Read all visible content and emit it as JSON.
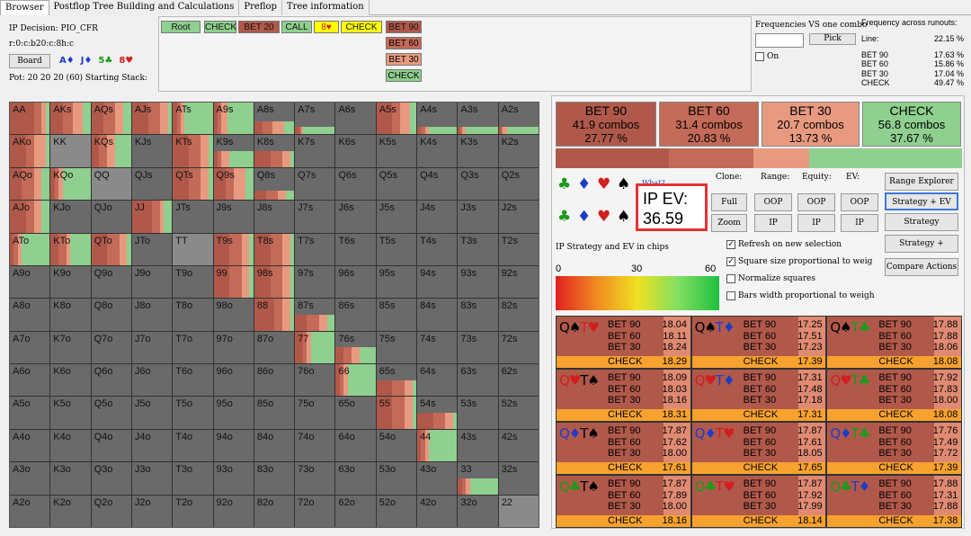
{
  "tabs": [
    "Browser",
    "Postflop Tree Building and Calculations",
    "Preflop",
    "Tree information"
  ],
  "info": {
    "decision": "IP Decision:   PIO_CFR",
    "board_line": "r:0:c:b20:c:8h:c",
    "board_button": "Board",
    "board_cards": [
      {
        "t": "A♦",
        "c": "#1e3cc8"
      },
      {
        "t": "J♦",
        "c": "#1e3cc8"
      },
      {
        "t": "5♣",
        "c": "#1a9b1a"
      },
      {
        "t": "8♥",
        "c": "#d21e1e"
      }
    ],
    "pot": "Pot: 20 20 20 (60) Starting Stack:"
  },
  "actions": {
    "row1": [
      {
        "label": "Root",
        "bg": "#8fcf8f"
      },
      {
        "label": "CHECK",
        "bg": "#8fcf8f"
      },
      {
        "label": "BET 20",
        "bg": "#b0594b"
      },
      {
        "label": "CALL",
        "bg": "#8fcf8f"
      },
      {
        "label": "8♥",
        "bg": "#ffff00"
      },
      {
        "label": "CHECK",
        "bg": "#ffff00"
      },
      {
        "label": "BET 90",
        "bg": "#b0594b"
      }
    ],
    "col": [
      {
        "label": "BET 60",
        "bg": "#c46a58"
      },
      {
        "label": "BET 30",
        "bg": "#e79a80"
      },
      {
        "label": "CHECK",
        "bg": "#8fcf8f"
      }
    ]
  },
  "freq": {
    "title": "Frequencies VS one combo",
    "pick": "Pick",
    "on": "On"
  },
  "runouts": {
    "title": "Frequency across runouts:",
    "line_label": "Line:",
    "line_value": "22.15 %",
    "rows": [
      [
        "BET 90",
        "17.63 %"
      ],
      [
        "BET 60",
        "15.86 %"
      ],
      [
        "BET 30",
        "17.04 %"
      ],
      [
        "CHECK",
        "49.47 %"
      ]
    ]
  },
  "summary": [
    {
      "name": "BET 90",
      "combos": "41.9 combos",
      "pct": "27.77 %",
      "bg": "#b0594b"
    },
    {
      "name": "BET 60",
      "combos": "31.4 combos",
      "pct": "20.83 %",
      "bg": "#c46a58"
    },
    {
      "name": "BET 30",
      "combos": "20.7 combos",
      "pct": "13.73 %",
      "bg": "#e79a80"
    },
    {
      "name": "CHECK",
      "combos": "56.8 combos",
      "pct": "37.67 %",
      "bg": "#8fcf8f"
    }
  ],
  "ev": {
    "label": "IP EV:",
    "value": "36.59",
    "what": "What?",
    "strategy_label": "IP Strategy and EV in chips",
    "scale": [
      "0",
      "30",
      "60"
    ]
  },
  "controls": {
    "clone": "Clone:",
    "range": "Range:",
    "equity": "Equity:",
    "evl": "EV:",
    "full": "Full",
    "zoom": "Zoom",
    "oop": "OOP",
    "ip": "IP",
    "range_explorer": "Range Explorer",
    "strategy_ev": "Strategy + EV",
    "strategy": "Strategy",
    "strategy_plus": "Strategy +",
    "compare": "Compare Actions"
  },
  "checks": [
    {
      "label": "Refresh on new selection",
      "on": true
    },
    {
      "label": "Square size proportional to weig",
      "on": true
    },
    {
      "label": "Normalize squares",
      "on": false
    },
    {
      "label": "Bars width proportional to weigh",
      "on": false
    }
  ],
  "grid": [
    [
      "AA",
      "AKs",
      "AQs",
      "AJs",
      "ATs",
      "A9s",
      "A8s",
      "A7s",
      "A6s",
      "A5s",
      "A4s",
      "A3s",
      "A2s"
    ],
    [
      "AKo",
      "KK",
      "KQs",
      "KJs",
      "KTs",
      "K9s",
      "K8s",
      "K7s",
      "K6s",
      "K5s",
      "K4s",
      "K3s",
      "K2s"
    ],
    [
      "AQo",
      "KQo",
      "QQ",
      "QJs",
      "QTs",
      "Q9s",
      "Q8s",
      "Q7s",
      "Q6s",
      "Q5s",
      "Q4s",
      "Q3s",
      "Q2s"
    ],
    [
      "AJo",
      "KJo",
      "QJo",
      "JJ",
      "JTs",
      "J9s",
      "J8s",
      "J7s",
      "J6s",
      "J5s",
      "J4s",
      "J3s",
      "J2s"
    ],
    [
      "ATo",
      "KTo",
      "QTo",
      "JTo",
      "TT",
      "T9s",
      "T8s",
      "T7s",
      "T6s",
      "T5s",
      "T4s",
      "T3s",
      "T2s"
    ],
    [
      "A9o",
      "K9o",
      "Q9o",
      "J9o",
      "T9o",
      "99",
      "98s",
      "97s",
      "96s",
      "95s",
      "94s",
      "93s",
      "92s"
    ],
    [
      "A8o",
      "K8o",
      "Q8o",
      "J8o",
      "T8o",
      "98o",
      "88",
      "87s",
      "86s",
      "85s",
      "84s",
      "83s",
      "82s"
    ],
    [
      "A7o",
      "K7o",
      "Q7o",
      "J7o",
      "T7o",
      "97o",
      "87o",
      "77",
      "76s",
      "75s",
      "74s",
      "73s",
      "72s"
    ],
    [
      "A6o",
      "K6o",
      "Q6o",
      "J6o",
      "T6o",
      "96o",
      "86o",
      "76o",
      "66",
      "65s",
      "64s",
      "63s",
      "62s"
    ],
    [
      "A5o",
      "K5o",
      "Q5o",
      "J5o",
      "T5o",
      "95o",
      "85o",
      "75o",
      "65o",
      "55",
      "54s",
      "53s",
      "52s"
    ],
    [
      "A4o",
      "K4o",
      "Q4o",
      "J4o",
      "T4o",
      "94o",
      "84o",
      "74o",
      "64o",
      "54o",
      "44",
      "43s",
      "42s"
    ],
    [
      "A3o",
      "K3o",
      "Q3o",
      "J3o",
      "T3o",
      "93o",
      "83o",
      "73o",
      "63o",
      "53o",
      "43o",
      "33",
      "32s"
    ],
    [
      "A2o",
      "K2o",
      "Q2o",
      "J2o",
      "T2o",
      "92o",
      "82o",
      "72o",
      "62o",
      "52o",
      "42o",
      "32o",
      "22"
    ]
  ],
  "combos": [
    {
      "hand": [
        {
          "t": "Q♠",
          "c": "#000"
        },
        {
          "t": "T♥",
          "c": "#d21e1e"
        }
      ],
      "vals": [
        "18.04",
        "18.11",
        "18.24",
        "18.29"
      ]
    },
    {
      "hand": [
        {
          "t": "Q♠",
          "c": "#000"
        },
        {
          "t": "T♦",
          "c": "#1e3cc8"
        }
      ],
      "vals": [
        "17.25",
        "17.51",
        "17.23",
        "17.39"
      ]
    },
    {
      "hand": [
        {
          "t": "Q♠",
          "c": "#000"
        },
        {
          "t": "T♣",
          "c": "#1a9b1a"
        }
      ],
      "vals": [
        "17.88",
        "17.88",
        "18.06",
        "18.08"
      ]
    },
    {
      "hand": [
        {
          "t": "Q♥",
          "c": "#d21e1e"
        },
        {
          "t": "T♠",
          "c": "#000"
        }
      ],
      "vals": [
        "18.09",
        "18.03",
        "18.16",
        "18.31"
      ]
    },
    {
      "hand": [
        {
          "t": "Q♥",
          "c": "#d21e1e"
        },
        {
          "t": "T♦",
          "c": "#1e3cc8"
        }
      ],
      "vals": [
        "17.31",
        "17.48",
        "17.18",
        "17.31"
      ]
    },
    {
      "hand": [
        {
          "t": "Q♥",
          "c": "#d21e1e"
        },
        {
          "t": "T♣",
          "c": "#1a9b1a"
        }
      ],
      "vals": [
        "17.92",
        "17.83",
        "18.00",
        "18.08"
      ]
    },
    {
      "hand": [
        {
          "t": "Q♦",
          "c": "#1e3cc8"
        },
        {
          "t": "T♠",
          "c": "#000"
        }
      ],
      "vals": [
        "17.87",
        "17.62",
        "18.00",
        "17.61"
      ]
    },
    {
      "hand": [
        {
          "t": "Q♦",
          "c": "#1e3cc8"
        },
        {
          "t": "T♥",
          "c": "#d21e1e"
        }
      ],
      "vals": [
        "17.87",
        "17.61",
        "18.05",
        "17.65"
      ]
    },
    {
      "hand": [
        {
          "t": "Q♦",
          "c": "#1e3cc8"
        },
        {
          "t": "T♣",
          "c": "#1a9b1a"
        }
      ],
      "vals": [
        "17.76",
        "17.49",
        "17.72",
        "17.39"
      ]
    },
    {
      "hand": [
        {
          "t": "Q♣",
          "c": "#1a9b1a"
        },
        {
          "t": "T♠",
          "c": "#000"
        }
      ],
      "vals": [
        "17.87",
        "17.89",
        "18.00",
        "18.16"
      ]
    },
    {
      "hand": [
        {
          "t": "Q♣",
          "c": "#1a9b1a"
        },
        {
          "t": "T♥",
          "c": "#d21e1e"
        }
      ],
      "vals": [
        "17.87",
        "17.92",
        "17.99",
        "18.14"
      ]
    },
    {
      "hand": [
        {
          "t": "Q♣",
          "c": "#1a9b1a"
        },
        {
          "t": "T♦",
          "c": "#1e3cc8"
        }
      ],
      "vals": [
        "17.88",
        "17.31",
        "17.88",
        "17.38"
      ]
    }
  ],
  "combo_labels": [
    "BET 90",
    "BET 60",
    "BET 30",
    "CHECK"
  ]
}
